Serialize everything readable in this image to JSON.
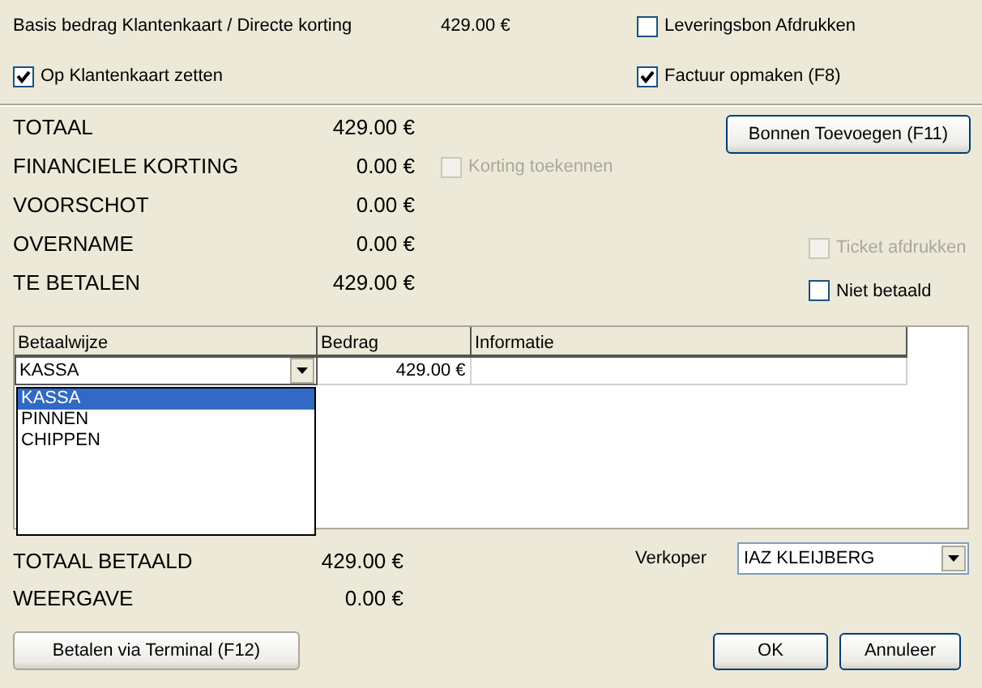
{
  "basis": {
    "label": "Basis bedrag Klantenkaart / Directe korting",
    "amount": "429.00 €"
  },
  "leveringsbon": {
    "label": "Leveringsbon Afdrukken",
    "checked": false,
    "disabled": false
  },
  "klantenkaart": {
    "label": "Op Klantenkaart zetten",
    "checked": true,
    "disabled": false
  },
  "factuur": {
    "label": "Factuur opmaken (F8)",
    "checked": true,
    "disabled": false
  },
  "totals": [
    {
      "label": "TOTAAL",
      "value": "429.00 €"
    },
    {
      "label": "FINANCIELE KORTING",
      "value": "0.00 €"
    },
    {
      "label": "VOORSCHOT",
      "value": "0.00 €"
    },
    {
      "label": "OVERNAME",
      "value": "0.00 €"
    },
    {
      "label": "TE BETALEN",
      "value": "429.00 €"
    }
  ],
  "korting": {
    "label": "Korting toekennen",
    "checked": false,
    "disabled": true
  },
  "bonnen_button": "Bonnen Toevoegen (F11)",
  "ticket": {
    "label": "Ticket afdrukken",
    "checked": false,
    "disabled": true
  },
  "niet_betaald": {
    "label": "Niet betaald",
    "checked": false,
    "disabled": false
  },
  "payments": {
    "columns": [
      "Betaalwijze",
      "Bedrag",
      "Informatie"
    ],
    "rows": [
      {
        "betaalwijze": "KASSA",
        "bedrag": "429.00 €"
      }
    ],
    "dropdown_options": [
      {
        "label": "KASSA",
        "selected": true
      },
      {
        "label": "PINNEN",
        "selected": false
      },
      {
        "label": "CHIPPEN",
        "selected": false
      }
    ]
  },
  "summary": [
    {
      "label": "TOTAAL BETAALD",
      "value": "429.00 €"
    },
    {
      "label": "WEERGAVE",
      "value": "0.00 €"
    }
  ],
  "verkoper": {
    "label": "Verkoper",
    "value": "IAZ KLEIJBERG"
  },
  "buttons": {
    "terminal": "Betalen via Terminal (F12)",
    "ok": "OK",
    "cancel": "Annuleer"
  }
}
